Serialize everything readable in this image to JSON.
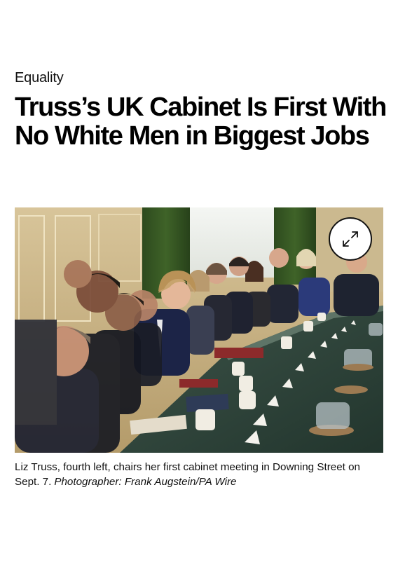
{
  "article": {
    "kicker": "Equality",
    "headline": "Truss’s UK Cabinet Is First With No White Men in Biggest Jobs"
  },
  "photo": {
    "expand_icon": "expand-arrows-icon"
  },
  "caption": {
    "text": "Liz Truss, fourth left, chairs her first cabinet meeting in Downing Street on Sept. 7.",
    "credit": "Photographer: Frank Augstein/PA Wire"
  }
}
